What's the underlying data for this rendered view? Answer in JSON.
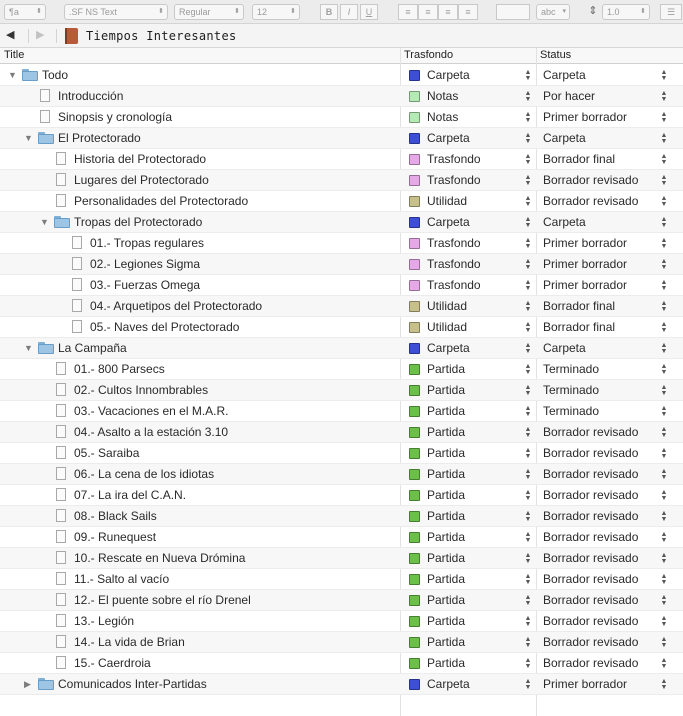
{
  "format_bar": {
    "paragraph_style": "¶a",
    "font_name": ".SF NS Text",
    "font_weight": "Regular",
    "font_size": "12",
    "bold": "B",
    "italic": "I",
    "underline": "U",
    "spell": "abc",
    "line_spacing": "1.0"
  },
  "header": {
    "back_icon": "◀",
    "forward_icon": "▶",
    "title": "Tiempos Interesantes"
  },
  "columns": {
    "title": "Title",
    "trasfondo": "Trasfondo",
    "status": "Status"
  },
  "colors": {
    "Carpeta": "#3d4fd6",
    "Notas": "#b4ebb4",
    "Trasfondo": "#e6a8e6",
    "Utilidad": "#c8c08a",
    "Partida": "#6cc04a"
  },
  "rows": [
    {
      "title": "Todo",
      "type": "folder",
      "level": 0,
      "expanded": true,
      "trasfondo": "Carpeta",
      "status": "Carpeta"
    },
    {
      "title": "Introducción",
      "type": "page",
      "level": 1,
      "trasfondo": "Notas",
      "status": "Por hacer"
    },
    {
      "title": "Sinopsis y cronología",
      "type": "page",
      "level": 1,
      "trasfondo": "Notas",
      "status": "Primer borrador"
    },
    {
      "title": "El Protectorado",
      "type": "folder",
      "level": 1,
      "expanded": true,
      "trasfondo": "Carpeta",
      "status": "Carpeta"
    },
    {
      "title": "Historia del Protectorado",
      "type": "page",
      "level": 2,
      "trasfondo": "Trasfondo",
      "status": "Borrador final"
    },
    {
      "title": "Lugares del Protectorado",
      "type": "page",
      "level": 2,
      "trasfondo": "Trasfondo",
      "status": "Borrador revisado"
    },
    {
      "title": "Personalidades del Protectorado",
      "type": "page",
      "level": 2,
      "trasfondo": "Utilidad",
      "status": "Borrador revisado"
    },
    {
      "title": "Tropas del Protectorado",
      "type": "folder",
      "level": 2,
      "expanded": true,
      "trasfondo": "Carpeta",
      "status": "Carpeta"
    },
    {
      "title": "01.- Tropas regulares",
      "type": "page",
      "level": 3,
      "trasfondo": "Trasfondo",
      "status": "Primer borrador"
    },
    {
      "title": "02.- Legiones Sigma",
      "type": "page",
      "level": 3,
      "trasfondo": "Trasfondo",
      "status": "Primer borrador"
    },
    {
      "title": "03.- Fuerzas Omega",
      "type": "page",
      "level": 3,
      "trasfondo": "Trasfondo",
      "status": "Primer borrador"
    },
    {
      "title": "04.- Arquetipos del Protectorado",
      "type": "page",
      "level": 3,
      "trasfondo": "Utilidad",
      "status": "Borrador final"
    },
    {
      "title": "05.- Naves del Protectorado",
      "type": "page",
      "level": 3,
      "trasfondo": "Utilidad",
      "status": "Borrador final"
    },
    {
      "title": "La Campaña",
      "type": "folder",
      "level": 1,
      "expanded": true,
      "trasfondo": "Carpeta",
      "status": "Carpeta"
    },
    {
      "title": "01.- 800 Parsecs",
      "type": "page",
      "level": 2,
      "trasfondo": "Partida",
      "status": "Terminado"
    },
    {
      "title": "02.- Cultos Innombrables",
      "type": "page",
      "level": 2,
      "trasfondo": "Partida",
      "status": "Terminado"
    },
    {
      "title": "03.- Vacaciones en el M.A.R.",
      "type": "page",
      "level": 2,
      "trasfondo": "Partida",
      "status": "Terminado"
    },
    {
      "title": "04.- Asalto a la estación 3.10",
      "type": "page",
      "level": 2,
      "trasfondo": "Partida",
      "status": "Borrador revisado"
    },
    {
      "title": "05.- Saraiba",
      "type": "page",
      "level": 2,
      "trasfondo": "Partida",
      "status": "Borrador revisado"
    },
    {
      "title": "06.- La cena de los idiotas",
      "type": "page",
      "level": 2,
      "trasfondo": "Partida",
      "status": "Borrador revisado"
    },
    {
      "title": "07.- La ira del C.A.N.",
      "type": "page",
      "level": 2,
      "trasfondo": "Partida",
      "status": "Borrador revisado"
    },
    {
      "title": "08.- Black Sails",
      "type": "page",
      "level": 2,
      "trasfondo": "Partida",
      "status": "Borrador revisado"
    },
    {
      "title": "09.- Runequest",
      "type": "page",
      "level": 2,
      "trasfondo": "Partida",
      "status": "Borrador revisado"
    },
    {
      "title": "10.- Rescate en Nueva Drómina",
      "type": "page",
      "level": 2,
      "trasfondo": "Partida",
      "status": "Borrador revisado"
    },
    {
      "title": "11.- Salto al vacío",
      "type": "page",
      "level": 2,
      "trasfondo": "Partida",
      "status": "Borrador revisado"
    },
    {
      "title": "12.- El puente sobre el río Drenel",
      "type": "page",
      "level": 2,
      "trasfondo": "Partida",
      "status": "Borrador revisado"
    },
    {
      "title": "13.- Legión",
      "type": "page",
      "level": 2,
      "trasfondo": "Partida",
      "status": "Borrador revisado"
    },
    {
      "title": "14.- La vida de Brian",
      "type": "page",
      "level": 2,
      "trasfondo": "Partida",
      "status": "Borrador revisado"
    },
    {
      "title": "15.- Caerdroia",
      "type": "page",
      "level": 2,
      "trasfondo": "Partida",
      "status": "Borrador revisado"
    },
    {
      "title": "Comunicados Inter-Partidas",
      "type": "folder",
      "level": 1,
      "expanded": false,
      "trasfondo": "Carpeta",
      "status": "Primer borrador"
    }
  ]
}
